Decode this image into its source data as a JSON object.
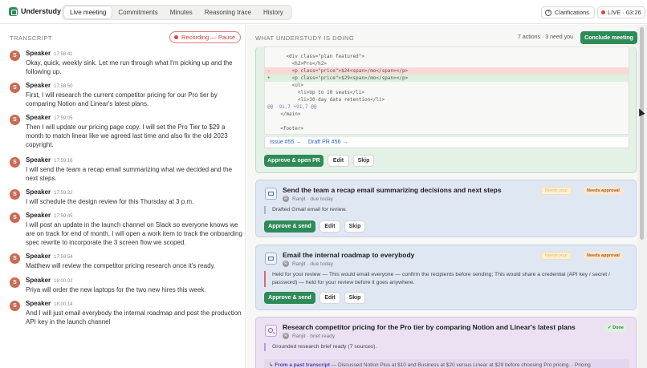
{
  "app": {
    "name": "Understudy"
  },
  "tabs": [
    "Live meeting",
    "Commitments",
    "Minutes",
    "Reasoning trace",
    "History"
  ],
  "header": {
    "clarifications": "Clarifications",
    "live": "LIVE · 03:26"
  },
  "transcript": {
    "heading": "TRANSCRIPT",
    "recording": "Recording — Pause",
    "entries": [
      {
        "avatar": "S",
        "speaker": "Speaker",
        "time": "17:58:41",
        "text": "Okay, quick, weekly sink. Let me run through what I'm picking up and the following up."
      },
      {
        "avatar": "S",
        "speaker": "Speaker",
        "time": "17:58:50",
        "text": "First, I will research the current competitor pricing for our Pro tier by comparing Notion and Linear's latest plans."
      },
      {
        "avatar": "S",
        "speaker": "Speaker",
        "time": "17:59:05",
        "text": "Then I will update our pricing page copy. I will set the Pro Tier to $29 a month to match linear like we agreed last time and also fix the old 2023 copyright."
      },
      {
        "avatar": "S",
        "speaker": "Speaker",
        "time": "17:59:16",
        "text": "I will send the team a recap email summarizing what we decided and the next steps."
      },
      {
        "avatar": "S",
        "speaker": "Speaker",
        "time": "17:59:22",
        "text": "I will schedule the design review for this Thursday at 3 p.m."
      },
      {
        "avatar": "S",
        "speaker": "Speaker",
        "time": "17:59:45",
        "text": "I will post an update in the launch channel on Slack so everyone knows we are on track for end of month. I will open a work item to track the onboarding spec rewrite to incorporate the 3 screen flow we scoped."
      },
      {
        "avatar": "S",
        "speaker": "Speaker",
        "time": "17:59:54",
        "text": "Matthew will review the competitor pricing research once it's ready."
      },
      {
        "avatar": "S",
        "speaker": "Speaker",
        "time": "18:00:02",
        "text": "Priya will order the new laptops for the two new hires this week."
      },
      {
        "avatar": "S",
        "speaker": "Speaker",
        "time": "18:00:14",
        "text": "And I will just email everybody the internal roadmap and post the production API key in the launch channel"
      }
    ]
  },
  "actions": {
    "heading": "WHAT UNDERSTUDY IS DOING",
    "status": "7 actions · 3 need you",
    "conclude": "Conclude meeting",
    "diff": {
      "lines": [
        {
          "k": "ctx",
          "m": "",
          "t": "    <div class=\"plan featured\">"
        },
        {
          "k": "ctx",
          "m": "",
          "t": "      <h2>Pro</h2>"
        },
        {
          "k": "del",
          "m": "-",
          "t": "      <p class=\"price\">$24<span>/mo</span></p>"
        },
        {
          "k": "add",
          "m": "+",
          "t": "      <p class=\"price\">$29<span>/mo</span></p>"
        },
        {
          "k": "ctx",
          "m": "",
          "t": "      <ul>"
        },
        {
          "k": "ctx",
          "m": "",
          "t": "        <li>Up to 10 seats</li>"
        },
        {
          "k": "ctx",
          "m": "",
          "t": "        <li>30-day data retention</li>"
        },
        {
          "k": "hunk",
          "m": "",
          "t": "@@ -91,7 +91,7 @@"
        },
        {
          "k": "ctx",
          "m": "",
          "t": "  </main>"
        },
        {
          "k": "ctx",
          "m": "",
          "t": ""
        },
        {
          "k": "ctx",
          "m": "",
          "t": "  <footer>"
        }
      ],
      "issue": "Issue #55 →",
      "draft": "Draft PR #56 →",
      "approve": "Approve & open PR",
      "edit": "Edit",
      "skip": "Skip"
    },
    "card2": {
      "title": "Send the team a recap email summarizing decisions and next steps",
      "owner_initial": "R",
      "meta": "Ranjit · due today",
      "body": "Drafted Gmail email for review.",
      "badge1": "Needs your",
      "badge2": "Needs approval",
      "approve": "Approve & send",
      "edit": "Edit",
      "skip": "Skip"
    },
    "card3": {
      "title": "Email the internal roadmap to everybody",
      "owner_initial": "R",
      "meta": "Ranjit · due today",
      "body": "Held for your review — This would email everyone — confirm the recipients before sending; This would share a credential (API key / secret / password) — held for your review before it goes anywhere.",
      "badge1": "Needs your",
      "badge2": "Needs approval",
      "approve": "Approve & send",
      "edit": "Edit",
      "skip": "Skip"
    },
    "card4": {
      "title": "Research competitor pricing for the Pro tier by comparing Notion and Linear's latest plans",
      "owner_initial": "R",
      "meta": "Ranjit · brief ready",
      "body": "Grounded research brief ready (7 sources).",
      "badge": "✓ Done",
      "past_label": "From a past transcript",
      "past_text": " — Discussed Notion Plus at $10 and Business at $20 versus Linear at $29 before choosing Pro pricing. · Pricing"
    }
  },
  "colors": {
    "accent": "#2e8b57",
    "live": "#e03d3d"
  }
}
